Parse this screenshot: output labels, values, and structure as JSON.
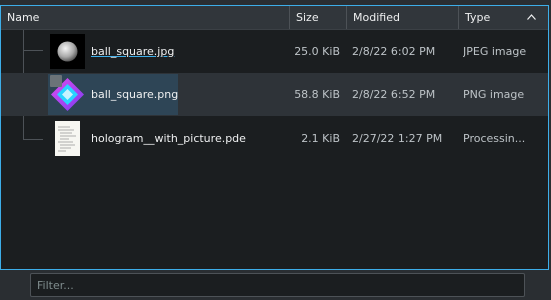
{
  "columns": {
    "name": "Name",
    "size": "Size",
    "modified": "Modified",
    "type": "Type"
  },
  "sort_icon": "chevron-up-icon",
  "files": [
    {
      "name": "ball_square.jpg",
      "size": "25.0 KiB",
      "modified": "2/8/22 6:02 PM",
      "type": "JPEG image",
      "thumbnail": "sphere-thumbnail"
    },
    {
      "name": "ball_square.png",
      "size": "58.8 KiB",
      "modified": "2/8/22 6:52 PM",
      "type": "PNG image",
      "thumbnail": "diamond-thumbnail"
    },
    {
      "name": "hologram__with_picture.pde",
      "size": "2.1 KiB",
      "modified": "2/27/22 1:27 PM",
      "type": "Processin...",
      "thumbnail": "document-thumbnail"
    }
  ],
  "filter": {
    "placeholder": "Filter..."
  },
  "colors": {
    "accent": "#3daee9",
    "view_bg": "#1b1e20",
    "header_bg": "#31363b",
    "window_bg": "#2a2e32"
  }
}
